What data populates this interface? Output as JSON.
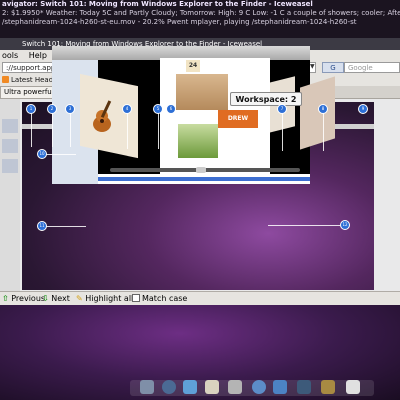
{
  "status": {
    "line1_prefix": "avigator: Switch 101: Moving from Windows Explorer to the Finder - Iceweasel",
    "line2": "2: $1.9950*  Weather: Today 5C and Partly Cloudy; Tomorrow: High: 9 C Low: -1 C a couple of showers; cooler; After tom... High: 8",
    "line3": "/stephanidream-1024-h260-st-eu.mov  -  20.2% Pwent mplayer, playing  /stephanidream-1024-h260-st"
  },
  "window": {
    "title": "Switch 101: Moving from Windows Explorer to the Finder - Iceweasel"
  },
  "menubar": {
    "items": [
      "ools",
      "Help"
    ]
  },
  "navbar": {
    "url": "://support.apple.com/kb/ht2512",
    "search_engine": "G",
    "search_placeholder": "Google"
  },
  "bookmarks": {
    "headlines_label": "Latest Headlines ▾"
  },
  "tabs": [
    {
      "label": "Ultra powerful WM for huma..."
    }
  ],
  "image": {
    "workspace_label": "Workspace: 2",
    "drew_label": "DREW",
    "badge_24": "24",
    "callouts": [
      "1",
      "2",
      "3",
      "4",
      "5",
      "6",
      "7",
      "8",
      "9",
      "10",
      "11",
      "12"
    ]
  },
  "findbar": {
    "previous": "Previous",
    "next": "Next",
    "highlight": "Highlight all",
    "match_case": "Match case"
  },
  "colors": {
    "accent": "#2d6fd6",
    "find_arrows": "#2e9a2a",
    "rss": "#f08a24"
  }
}
